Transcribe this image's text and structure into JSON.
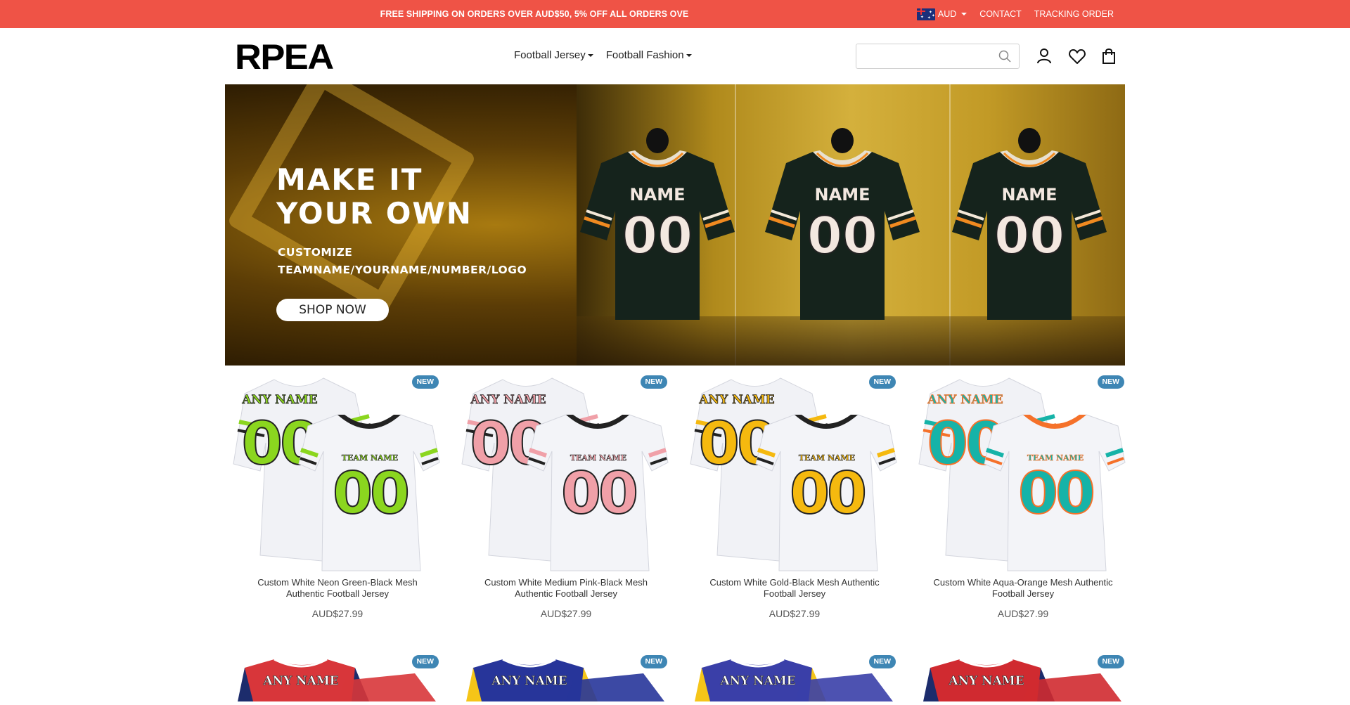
{
  "topbar": {
    "promo": "FREE SHIPPING ON ORDERS OVER AUD$50, 5% OFF ALL ORDERS OVE",
    "currency": "AUD",
    "links": [
      "CONTACT",
      "TRACKING ORDER"
    ]
  },
  "header": {
    "logo": "RPEA",
    "nav": [
      "Football Jersey",
      "Football Fashion"
    ],
    "search_placeholder": ""
  },
  "banner": {
    "title_line1": "MAKE IT",
    "title_line2": "YOUR OWN",
    "sub_line1": "CUSTOMIZE",
    "sub_line2": "TEAMNAME/YOURNAME/NUMBER/LOGO",
    "button": "SHOP NOW",
    "jersey_name": "NAME",
    "jersey_number": "00"
  },
  "products": [
    {
      "badge": "NEW",
      "title": "Custom White Neon Green-Black Mesh Authentic Football Jersey",
      "price": "AUD$27.99",
      "name_text": "ANY NAME",
      "team_text": "TEAM NAME",
      "number": "00",
      "color": "#8bd61f",
      "trim": "#222222"
    },
    {
      "badge": "NEW",
      "title": "Custom White Medium Pink-Black Mesh Authentic Football Jersey",
      "price": "AUD$27.99",
      "name_text": "ANY NAME",
      "team_text": "TEAM NAME",
      "number": "00",
      "color": "#f0a0a8",
      "trim": "#222222"
    },
    {
      "badge": "NEW",
      "title": "Custom White Gold-Black Mesh Authentic Football Jersey",
      "price": "AUD$27.99",
      "name_text": "ANY NAME",
      "team_text": "TEAM NAME",
      "number": "00",
      "color": "#f5b90f",
      "trim": "#222222"
    },
    {
      "badge": "NEW",
      "title": "Custom White Aqua-Orange Mesh Authentic Football Jersey",
      "price": "AUD$27.99",
      "name_text": "ANY NAME",
      "team_text": "TEAM NAME",
      "number": "00",
      "color": "#16b3a8",
      "trim": "#f5712a"
    }
  ],
  "products_row2": [
    {
      "badge": "NEW",
      "name_text": "ANY NAME",
      "body": "#d8363a",
      "sleeve": "#1c2c6c"
    },
    {
      "badge": "NEW",
      "name_text": "ANY NAME",
      "body": "#27359a",
      "sleeve": "#f5c518"
    },
    {
      "badge": "NEW",
      "name_text": "ANY NAME",
      "body": "#3a3fa8",
      "sleeve": "#f5c518"
    },
    {
      "badge": "NEW",
      "name_text": "ANY NAME",
      "body": "#d02a30",
      "sleeve": "#1c2c6c"
    }
  ]
}
